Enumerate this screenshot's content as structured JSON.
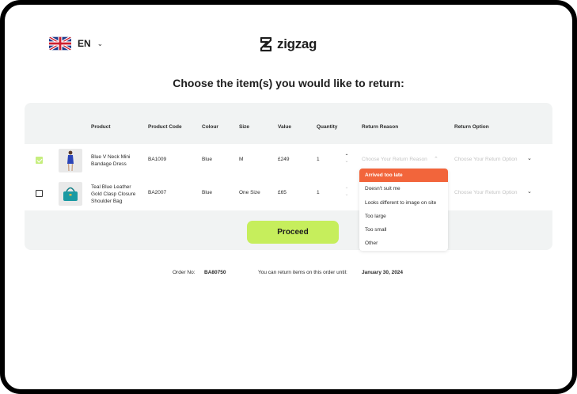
{
  "header": {
    "language": "EN",
    "brand": "zigzag"
  },
  "page_title": "Choose the item(s) you would like to return:",
  "table": {
    "columns": {
      "product": "Product",
      "product_code": "Product Code",
      "colour": "Colour",
      "size": "Size",
      "value": "Value",
      "quantity": "Quantity",
      "return_reason": "Return Reason",
      "return_option": "Return Option"
    },
    "rows": [
      {
        "selected": true,
        "name": "Blue V Neck Mini Bandage Dress",
        "code": "BA1009",
        "colour": "Blue",
        "size": "M",
        "value": "£249",
        "quantity": "1",
        "reason_placeholder": "Choose Your Return Reason",
        "option_placeholder": "Choose Your Return Option"
      },
      {
        "selected": false,
        "name": "Teal Blue Leather Gold Clasp Closure Shoulder Bag",
        "code": "BA2007",
        "colour": "Blue",
        "size": "One Size",
        "value": "£65",
        "quantity": "1",
        "reason_placeholder": "",
        "option_placeholder": "Choose Your Return Option"
      }
    ]
  },
  "reason_dropdown": {
    "options": [
      "Arrived too late",
      "Doesn't suit me",
      "Looks different to image on site",
      "Too large",
      "Too small",
      "Other"
    ],
    "highlighted": "Arrived too late"
  },
  "proceed_label": "Proceed",
  "footer": {
    "order_label": "Order No:",
    "order_number": "BA80750",
    "return_until_label": "You can return items on this order until:",
    "return_until_date": "January 30, 2024"
  },
  "colors": {
    "accent": "#c6ee5c",
    "highlight": "#f2653b",
    "panel": "#f1f3f3"
  },
  "icons": [
    "uk-flag-icon",
    "chevron-down-icon",
    "zigzag-logo-icon",
    "chevron-up-icon",
    "checkmark-icon"
  ]
}
